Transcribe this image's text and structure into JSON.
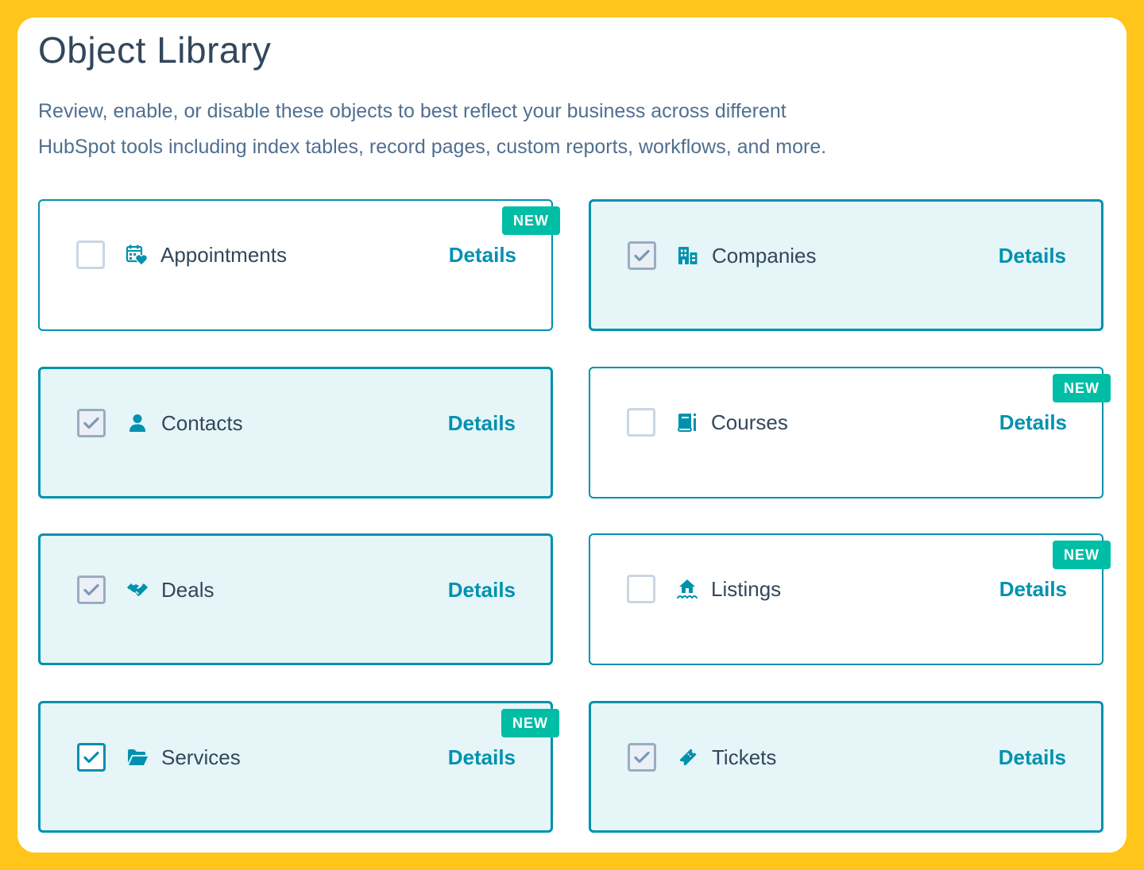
{
  "page": {
    "title": "Object Library",
    "description_line1": "Review, enable, or disable these objects to best reflect your business across different",
    "description_line2": "HubSpot tools including index tables, record pages, custom reports, workflows, and more."
  },
  "colors": {
    "background": "#FFC51A",
    "accent": "#0091ae",
    "badge": "#00bda5",
    "text": "#33475b",
    "enabled_card": "#e5f5f8"
  },
  "objects": [
    {
      "name": "Appointments",
      "icon": "calendar-heart-icon",
      "enabled": false,
      "is_new": true,
      "details_label": "Details",
      "badge_label": "NEW"
    },
    {
      "name": "Companies",
      "icon": "building-icon",
      "enabled": true,
      "is_new": false,
      "details_label": "Details"
    },
    {
      "name": "Contacts",
      "icon": "person-icon",
      "enabled": true,
      "is_new": false,
      "details_label": "Details"
    },
    {
      "name": "Courses",
      "icon": "book-icon",
      "enabled": false,
      "is_new": true,
      "details_label": "Details",
      "badge_label": "NEW"
    },
    {
      "name": "Deals",
      "icon": "handshake-icon",
      "enabled": true,
      "is_new": false,
      "details_label": "Details"
    },
    {
      "name": "Listings",
      "icon": "house-icon",
      "enabled": false,
      "is_new": true,
      "details_label": "Details",
      "badge_label": "NEW"
    },
    {
      "name": "Services",
      "icon": "folder-open-icon",
      "enabled": true,
      "is_new": true,
      "details_label": "Details",
      "badge_label": "NEW"
    },
    {
      "name": "Tickets",
      "icon": "ticket-icon",
      "enabled": true,
      "is_new": false,
      "details_label": "Details"
    }
  ]
}
